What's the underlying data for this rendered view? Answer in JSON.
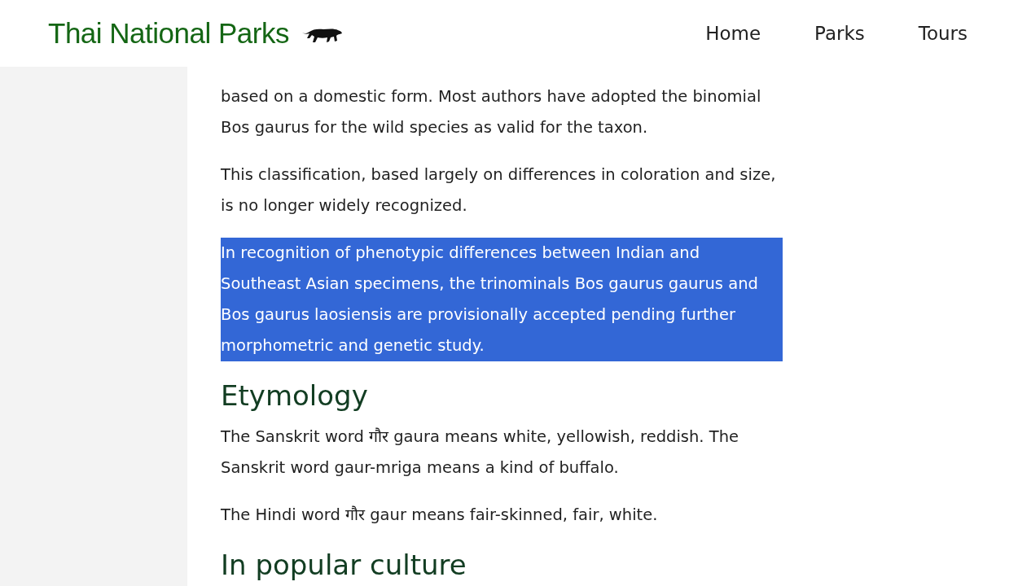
{
  "header": {
    "site_title": "Thai National Parks",
    "nav": [
      {
        "label": "Home"
      },
      {
        "label": "Parks"
      },
      {
        "label": "Tours"
      }
    ]
  },
  "article": [
    {
      "kind": "paragraph",
      "text": "based on a domestic form. Most authors have adopted the binomial Bos gaurus for the wild species as valid for the taxon.",
      "selected": false
    },
    {
      "kind": "paragraph",
      "text": "This classification, based largely on differences in coloration and size, is no longer widely recognized.",
      "selected": false
    },
    {
      "kind": "paragraph",
      "text": "In recognition of phenotypic differences between Indian and Southeast Asian specimens, the trinominals Bos gaurus gaurus and Bos gaurus laosiensis are provisionally accepted pending further morphometric and genetic study.",
      "selected": true
    },
    {
      "kind": "heading",
      "text": "Etymology"
    },
    {
      "kind": "paragraph",
      "text": "The Sanskrit word गौर gaura means white, yellowish, reddish. The Sanskrit word gaur-mriga means a kind of buffalo.",
      "selected": false
    },
    {
      "kind": "paragraph",
      "text": "The Hindi word गौर gaur means fair-skinned, fair, white.",
      "selected": false
    },
    {
      "kind": "heading",
      "text": "In popular culture"
    }
  ]
}
